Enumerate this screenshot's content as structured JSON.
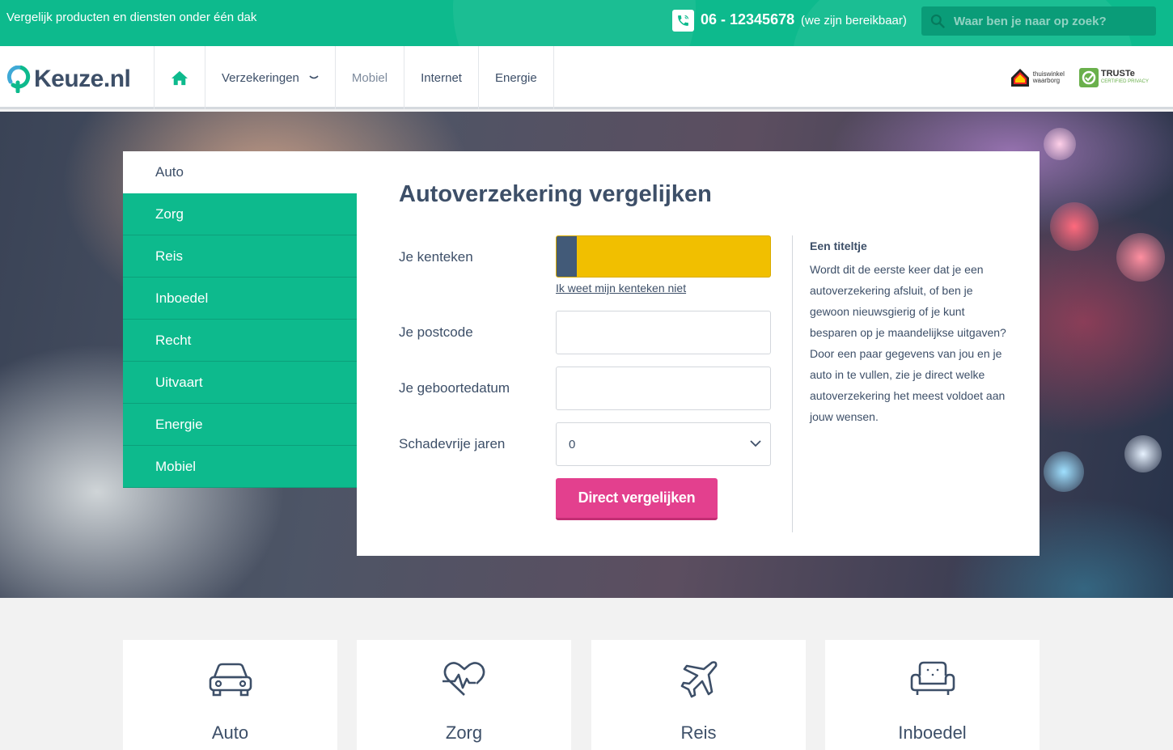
{
  "topbar": {
    "tagline": "Vergelijk producten en diensten onder één dak",
    "phone_number": "06 - 12345678",
    "phone_note": "(we zijn bereikbaar)",
    "search_placeholder": "Waar ben je naar op zoek?"
  },
  "nav": {
    "logo_main": "Keuze",
    "logo_tld": ".nl",
    "items": [
      {
        "label": "Verzekeringen",
        "has_dropdown": true
      },
      {
        "label": "Mobiel",
        "active": true
      },
      {
        "label": "Internet"
      },
      {
        "label": "Energie"
      }
    ],
    "badges": {
      "thuiswinkel_line1": "thuiswinkel",
      "thuiswinkel_line2": "waarborg",
      "truste_title": "TRUSTe",
      "truste_sub": "CERTIFIED PRIVACY"
    }
  },
  "side_tabs": [
    {
      "label": "Auto",
      "active": true
    },
    {
      "label": "Zorg"
    },
    {
      "label": "Reis"
    },
    {
      "label": "Inboedel"
    },
    {
      "label": "Recht"
    },
    {
      "label": "Uitvaart"
    },
    {
      "label": "Energie"
    },
    {
      "label": "Mobiel"
    }
  ],
  "form": {
    "title": "Autoverzekering vergelijken",
    "kenteken_label": "Je kenteken",
    "kenteken_value": "",
    "kenteken_link": "Ik weet mijn kenteken niet",
    "postcode_label": "Je postcode",
    "postcode_value": "",
    "geboortedatum_label": "Je geboortedatum",
    "geboortedatum_value": "",
    "schadevrij_label": "Schadevrije jaren",
    "schadevrij_value": "0",
    "submit_label": "Direct vergelijken"
  },
  "info": {
    "title": "Een titeltje",
    "text": "Wordt dit de eerste keer dat je een autoverzekering afsluit, of ben je gewoon nieuwsgierig of je kunt besparen op je maandelijkse uitgaven? Door een paar gegevens van jou en je auto in te vullen, zie je direct welke autoverzekering het meest voldoet aan jouw wensen."
  },
  "product_cards": [
    {
      "label": "Auto",
      "icon": "car-icon"
    },
    {
      "label": "Zorg",
      "icon": "heartbeat-icon"
    },
    {
      "label": "Reis",
      "icon": "airplane-icon"
    },
    {
      "label": "Inboedel",
      "icon": "sofa-icon"
    }
  ],
  "colors": {
    "brand_green": "#0dba8d",
    "cta_pink": "#e3408e",
    "text_navy": "#3d4f68",
    "plate_yellow": "#f1bf00"
  }
}
